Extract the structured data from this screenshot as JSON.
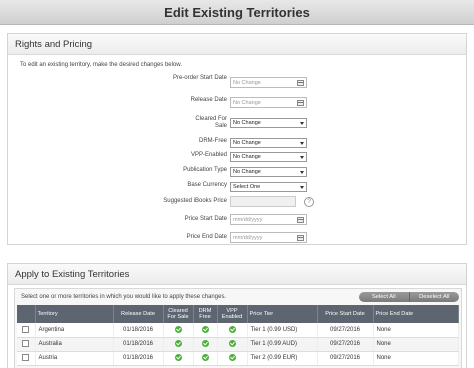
{
  "header": {
    "title": "Edit Existing Territories"
  },
  "rights": {
    "title": "Rights and Pricing",
    "intro": "To edit an existing territory, make the desired changes below.",
    "fields": {
      "preorder": {
        "label": "Pre-order Start Date",
        "placeholder": "No Change"
      },
      "release": {
        "label": "Release Date",
        "placeholder": "No Change"
      },
      "cleared": {
        "label": "Cleared For Sale",
        "value": "No Change"
      },
      "drm": {
        "label": "DRM-Free",
        "value": "No Change"
      },
      "vpp": {
        "label": "VPP-Enabled",
        "value": "No Change"
      },
      "pubtype": {
        "label": "Publication Type",
        "value": "No Change"
      },
      "currency": {
        "label": "Base Currency",
        "value": "Select One"
      },
      "suggested": {
        "label": "Suggested iBooks Price",
        "help": "?"
      },
      "pstart": {
        "label": "Price Start Date",
        "placeholder": "mm/dd/yyyy"
      },
      "pend": {
        "label": "Price End Date",
        "placeholder": "mm/dd/yyyy"
      }
    }
  },
  "apply": {
    "title": "Apply to Existing Territories",
    "hint": "Select one or more territories in which you would like to apply these changes.",
    "select_all": "Select All",
    "deselect_all": "Deselect All",
    "columns": [
      "Territory",
      "Release Date",
      "Cleared For Sale",
      "DRM Free",
      "VPP Enabled",
      "Price Tier",
      "Price Start Date",
      "Price End Date"
    ],
    "rows": [
      {
        "territory": "Argentina",
        "release": "01/18/2016",
        "tier": "Tier 1 (0.99 USD)",
        "pstart": "09/27/2016",
        "pend": "None"
      },
      {
        "territory": "Australia",
        "release": "01/18/2016",
        "tier": "Tier 1 (0.99 AUD)",
        "pstart": "09/27/2016",
        "pend": "None"
      },
      {
        "territory": "Austria",
        "release": "01/18/2016",
        "tier": "Tier 2 (0.99 EUR)",
        "pstart": "09/27/2016",
        "pend": "None"
      }
    ]
  }
}
